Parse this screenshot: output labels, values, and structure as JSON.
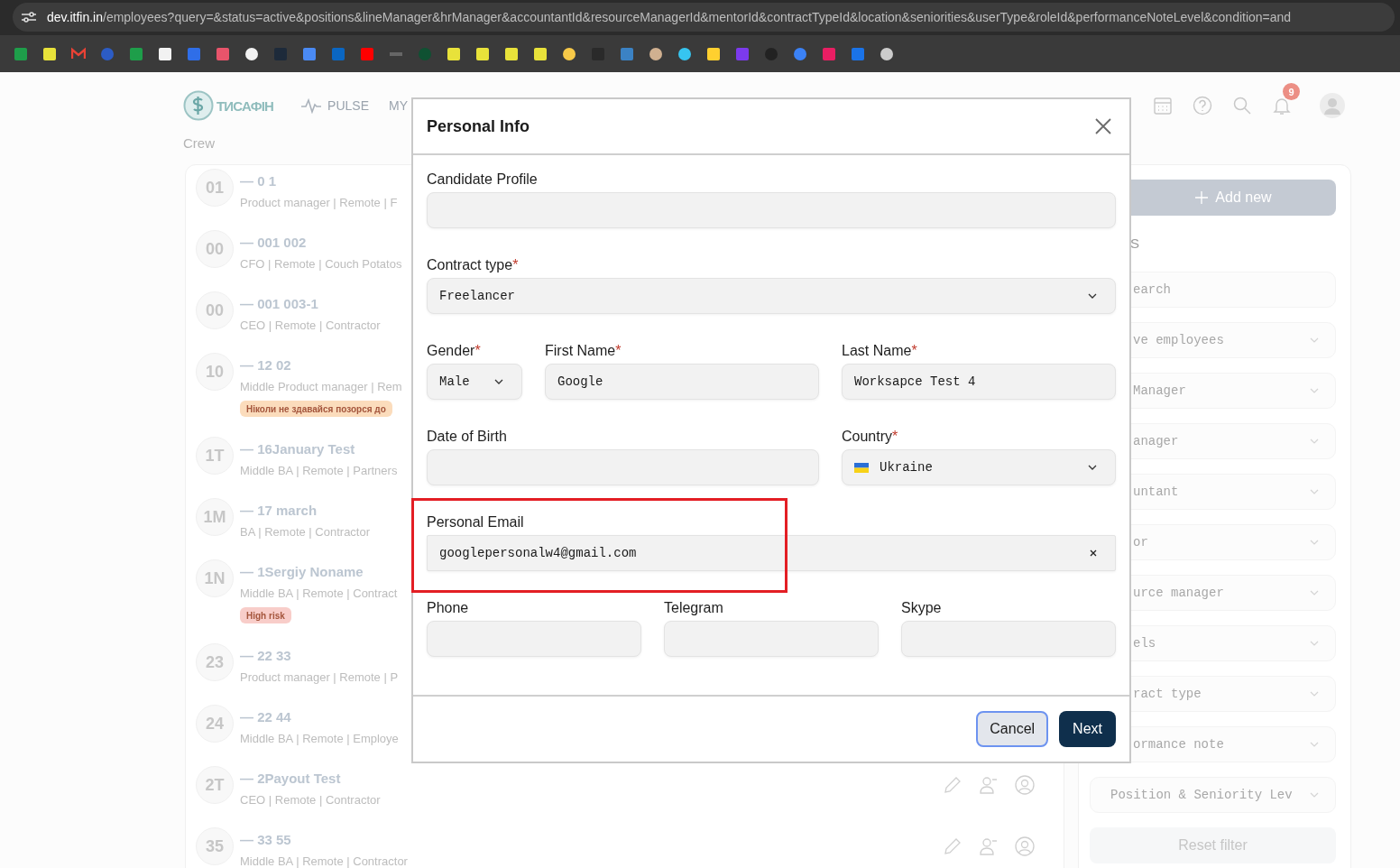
{
  "browser": {
    "url_host": "dev.itfin.in",
    "url_path": "/employees?query=&status=active&positions&lineManager&hrManager&accountantId&resourceManagerId&mentorId&contractTypeId&location&seniorities&userType&roleId&performanceNoteLevel&condition=and"
  },
  "header": {
    "logo_text": "ТИСАФІН",
    "nav": [
      "PULSE",
      "MY"
    ],
    "notification_count": "9"
  },
  "crew_title": "Crew",
  "employees": [
    {
      "initials": "01",
      "name": "— 0 1",
      "details": "Product manager | Remote | F"
    },
    {
      "initials": "00",
      "name": "— 001 002",
      "details": "CFO | Remote | Couch Potatos"
    },
    {
      "initials": "00",
      "name": "— 001 003-1",
      "details": "CEO | Remote | Contractor"
    },
    {
      "initials": "10",
      "name": "— 12 02",
      "details": "Middle Product manager | Rem",
      "tag": {
        "text": "Ніколи не здавайся позорся до",
        "color": "#fbdcbc"
      }
    },
    {
      "initials": "1T",
      "name": "— 16January Test",
      "details": "Middle BA | Remote | Partners"
    },
    {
      "initials": "1M",
      "name": "— 17 march",
      "details": "BA | Remote | Contractor"
    },
    {
      "initials": "1N",
      "name": "— 1Sergiy Noname",
      "details": "Middle BA | Remote | Contract",
      "tag": {
        "text": "High risk",
        "color": "#f8cdc9"
      }
    },
    {
      "initials": "23",
      "name": "— 22 33",
      "details": "Product manager | Remote | P"
    },
    {
      "initials": "24",
      "name": "— 22 44",
      "details": "Middle BA | Remote | Employe"
    },
    {
      "initials": "2T",
      "name": "— 2Payout Test",
      "details": "CEO | Remote | Contractor",
      "actions": true
    },
    {
      "initials": "35",
      "name": "— 33 55",
      "details": "Middle BA | Remote | Contractor",
      "actions": true
    }
  ],
  "filters": {
    "add_button": "Add new",
    "heading": "S",
    "fields": [
      {
        "kind": "search",
        "text": "earch"
      },
      {
        "kind": "select",
        "text": "ve employees"
      },
      {
        "kind": "select",
        "text": "Manager"
      },
      {
        "kind": "select",
        "text": "anager"
      },
      {
        "kind": "select",
        "text": "untant"
      },
      {
        "kind": "select",
        "text": "or"
      },
      {
        "kind": "select",
        "text": "urce manager"
      },
      {
        "kind": "select",
        "text": "els"
      },
      {
        "kind": "select",
        "text": "ract type"
      },
      {
        "kind": "select",
        "text": "ormance note"
      },
      {
        "kind": "select",
        "text": "Position & Seniority Lev"
      }
    ],
    "reset_button": "Reset filter"
  },
  "modal": {
    "title": "Personal Info",
    "fields": [
      {
        "label": "Candidate Profile",
        "kind": "text"
      },
      {
        "label": "Contract type",
        "required_mark": "*",
        "kind": "select",
        "value": "Freelancer"
      },
      {
        "label": "Gender",
        "required_mark": "*",
        "kind": "select",
        "value": "Male"
      },
      {
        "label": "First Name",
        "required_mark": "*",
        "kind": "text",
        "value": "Google"
      },
      {
        "label": "Last Name",
        "required_mark": "*",
        "kind": "text",
        "value": "Worksapce Test 4"
      },
      {
        "label": "Date of Birth",
        "kind": "text"
      },
      {
        "label": "Country",
        "required_mark": "*",
        "kind": "country",
        "value": "Ukraine"
      },
      {
        "label": "Personal Email",
        "kind": "clearable",
        "value": "googlepersonalw4@gmail.com"
      },
      {
        "label": "Phone",
        "kind": "text"
      },
      {
        "label": "Telegram",
        "kind": "text"
      },
      {
        "label": "Skype",
        "kind": "text"
      }
    ],
    "buttons": [
      {
        "label": "Cancel",
        "kind": "secondary",
        "focused": true
      },
      {
        "label": "Next",
        "kind": "primary",
        "focused": false
      }
    ]
  }
}
